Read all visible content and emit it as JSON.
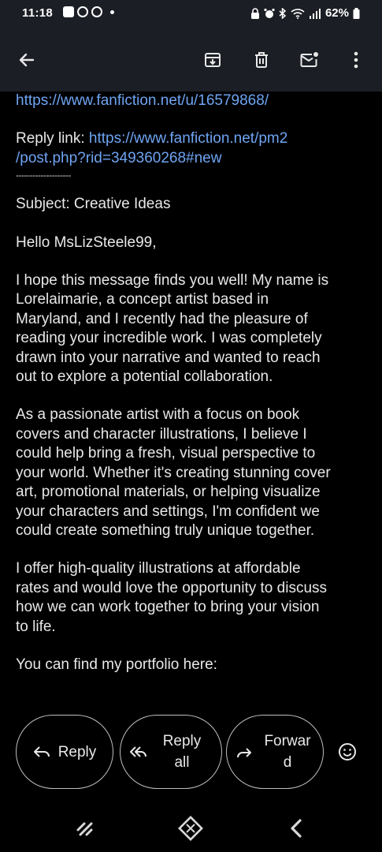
{
  "status_bar": {
    "time": "11:18",
    "battery": "62%",
    "left_icons": [
      "gallery-icon",
      "whatsapp-icon",
      "whatsapp-icon",
      "dot-icon"
    ],
    "right_icons": [
      "lock-icon",
      "alarm-icon",
      "bluetooth-icon",
      "wifi-icon",
      "signal-icon",
      "battery-icon"
    ]
  },
  "toolbar": {
    "icons": [
      "back-arrow-icon",
      "archive-icon",
      "delete-icon",
      "mark-unread-icon",
      "more-icon"
    ]
  },
  "email": {
    "profile_link": "https://www.fanfiction.net/u/16579868/",
    "reply_label": "Reply link: ",
    "reply_url": "https://www.fanfiction.net/pm2\n/post.php?rid=349360268#new",
    "divider": "--------------------",
    "subject": "Subject: Creative Ideas",
    "greeting": "Hello MsLizSteele99,",
    "paragraph1": "I hope this message finds you well! My name is\nLorelaimarie, a concept artist based in\nMaryland, and I recently had the pleasure of\nreading your incredible work. I was completely\ndrawn into your narrative and wanted to reach\nout to explore a potential collaboration.",
    "paragraph2": "As a passionate artist with a focus on book\ncovers and character illustrations, I believe I\ncould help bring a fresh, visual perspective to\nyour world. Whether it's creating stunning cover\nart, promotional materials, or helping visualize\nyour characters and settings, I'm confident we\ncould create something truly unique together.",
    "paragraph3": "I offer high-quality illustrations at affordable\nrates and would love the opportunity to discuss\nhow we can work together to bring your vision\nto life.",
    "paragraph4": "You can find my portfolio here:"
  },
  "actions": {
    "reply": "Reply",
    "reply_all": "Reply\nall",
    "forward": "Forwar\nd"
  },
  "nav": {
    "icons": [
      "recent-apps-icon",
      "home-icon",
      "back-icon"
    ]
  }
}
